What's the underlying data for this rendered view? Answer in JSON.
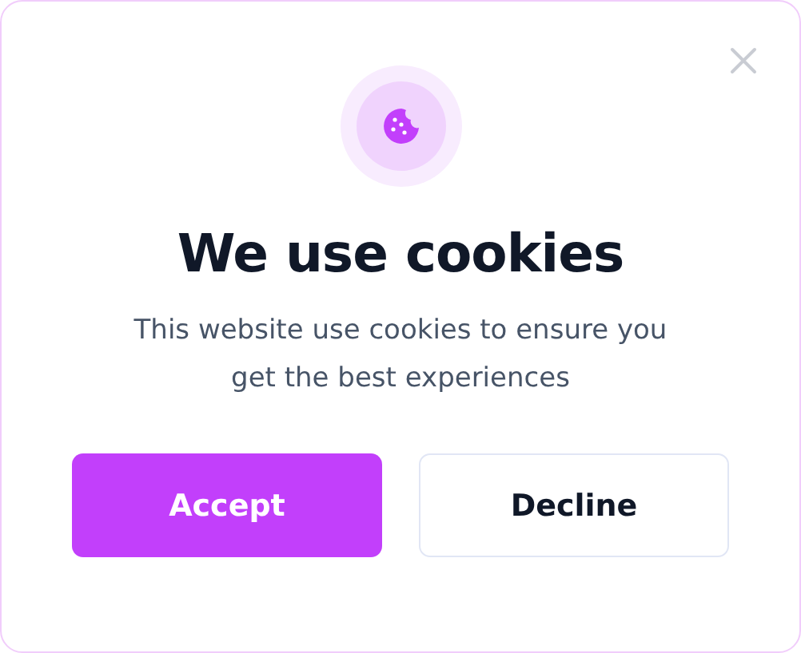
{
  "dialog": {
    "title": "We use cookies",
    "message": "This website use cookies to ensure you get the best experiences",
    "buttons": [
      {
        "label": "Accept",
        "kind": "primary"
      },
      {
        "label": "Decline",
        "kind": "secondary"
      }
    ]
  }
}
